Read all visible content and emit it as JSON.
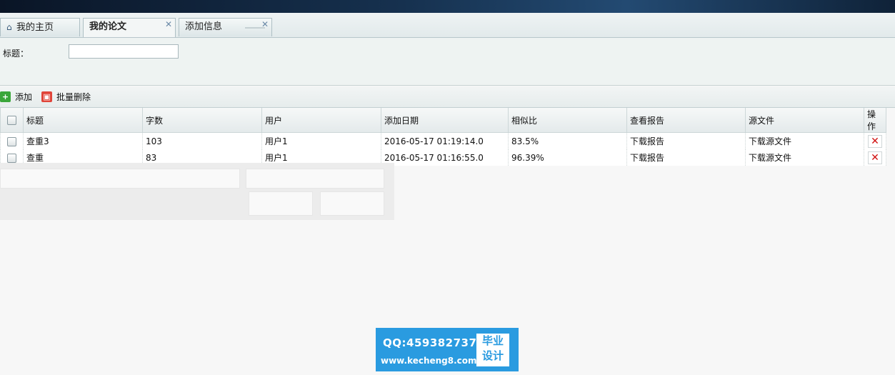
{
  "tabs": [
    {
      "label": "我的主页",
      "icon": "home-icon",
      "closable": false,
      "active": false
    },
    {
      "label": "我的论文",
      "closable": true,
      "active": true
    },
    {
      "label": "添加信息",
      "closable": true,
      "active": false
    }
  ],
  "search": {
    "title_label": "标题：",
    "title_value": ""
  },
  "toolbar": {
    "add_label": "添加",
    "batch_delete_label": "批量删除"
  },
  "table": {
    "columns": [
      "标题",
      "字数",
      "用户",
      "添加日期",
      "相似比",
      "查看报告",
      "源文件",
      "操作"
    ],
    "rows": [
      {
        "title": "查重3",
        "words": "103",
        "user": "用户1",
        "date": "2016-05-17 01:19:14.0",
        "similarity": "83.5%",
        "report": "下载报告",
        "source": "下载源文件"
      },
      {
        "title": "查重",
        "words": "83",
        "user": "用户1",
        "date": "2016-05-17 01:16:55.0",
        "similarity": "96.39%",
        "report": "下载报告",
        "source": "下载源文件"
      }
    ]
  },
  "watermark": {
    "qq": "QQ:459382737",
    "url": "www.kecheng8.com",
    "badge_line1": "毕业",
    "badge_line2": "设计"
  },
  "colors": {
    "watermark_bg": "#2a9be0",
    "delete_red": "#d01010",
    "add_green": "#3aa63a",
    "batch_delete_red": "#e0453a"
  }
}
